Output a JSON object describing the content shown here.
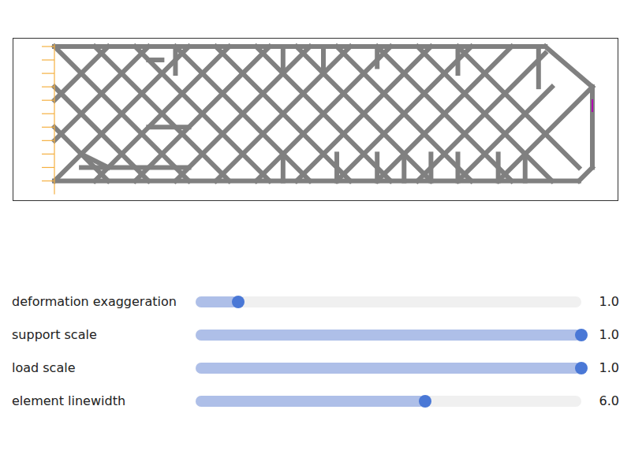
{
  "figure": {
    "structure": {
      "element_color": "#808080",
      "elements": [
        [
          0,
          0,
          36.5,
          0
        ],
        [
          36.5,
          0,
          40,
          3
        ],
        [
          40,
          3,
          40,
          9
        ],
        [
          40,
          9,
          39,
          10
        ],
        [
          0,
          10,
          39,
          10
        ],
        [
          0,
          0,
          10,
          10
        ],
        [
          3,
          0,
          13,
          10
        ],
        [
          6,
          0,
          16,
          10
        ],
        [
          9,
          0,
          19,
          10
        ],
        [
          12,
          0,
          22,
          10
        ],
        [
          15,
          0,
          25,
          10
        ],
        [
          18,
          0,
          28,
          10
        ],
        [
          21,
          0,
          31,
          10
        ],
        [
          24,
          0,
          34,
          10
        ],
        [
          27,
          0,
          37,
          10
        ],
        [
          30,
          0,
          39,
          9
        ],
        [
          0,
          3,
          7,
          10
        ],
        [
          0,
          6,
          4,
          10
        ],
        [
          0,
          10,
          10,
          0
        ],
        [
          3,
          10,
          13,
          0
        ],
        [
          6,
          10,
          16,
          0
        ],
        [
          9,
          10,
          19,
          0
        ],
        [
          12,
          10,
          22,
          0
        ],
        [
          15,
          10,
          25,
          0
        ],
        [
          18,
          10,
          28,
          0
        ],
        [
          21,
          10,
          31,
          0
        ],
        [
          24,
          10,
          34,
          0
        ],
        [
          27,
          10,
          36.5,
          0.5
        ],
        [
          30,
          10,
          37,
          3
        ],
        [
          33,
          10,
          40,
          3
        ],
        [
          0,
          4,
          4,
          0
        ],
        [
          0,
          7,
          7,
          0
        ],
        [
          9,
          0,
          9,
          2
        ],
        [
          17,
          0,
          17,
          2
        ],
        [
          20,
          0,
          20,
          2
        ],
        [
          24,
          0,
          24,
          1.5
        ],
        [
          30,
          0,
          30,
          2
        ],
        [
          36,
          0,
          36,
          3
        ],
        [
          17,
          8,
          17,
          10
        ],
        [
          21,
          8,
          21,
          10
        ],
        [
          24,
          8,
          24,
          10
        ],
        [
          26,
          8,
          26,
          10
        ],
        [
          28,
          8,
          28,
          10
        ],
        [
          30,
          8,
          30,
          10
        ],
        [
          33,
          8,
          33,
          10
        ],
        [
          35,
          8,
          35,
          10
        ],
        [
          2,
          9,
          10,
          9
        ],
        [
          7,
          1,
          8,
          1
        ],
        [
          7,
          6,
          10,
          6
        ],
        [
          2,
          8,
          4,
          9
        ]
      ]
    },
    "supports": {
      "color": "#f5b041",
      "y": [
        0,
        1,
        2,
        3,
        4,
        5,
        6,
        7,
        8,
        9,
        10
      ]
    },
    "load": {
      "x": 40,
      "y": 4.4,
      "color": "#b000b0"
    }
  },
  "sliders": [
    {
      "label": "deformation exaggeration",
      "level": 0.11,
      "reading": "1.0"
    },
    {
      "label": "support scale",
      "level": 1.0,
      "reading": "1.0"
    },
    {
      "label": "load scale",
      "level": 1.0,
      "reading": "1.0"
    },
    {
      "label": "element linewidth",
      "level": 0.595,
      "reading": "6.0"
    }
  ]
}
